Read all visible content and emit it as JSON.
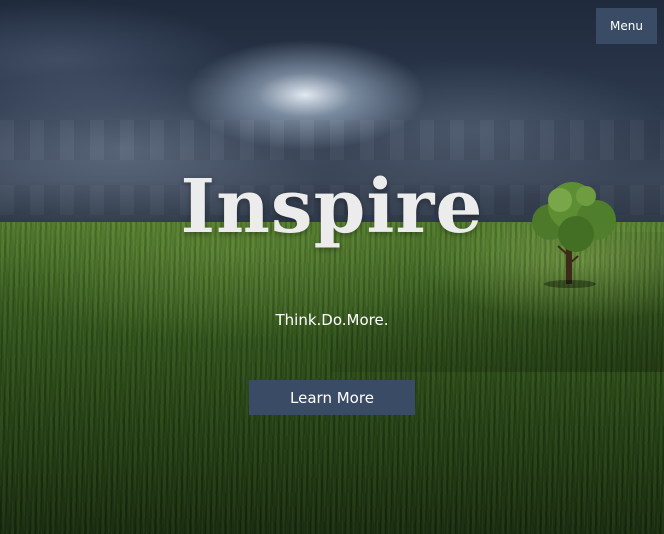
{
  "header": {
    "menu_label": "Menu"
  },
  "hero": {
    "title": "Inspire",
    "tagline": "Think.Do.More.",
    "cta_label": "Learn More",
    "background_description_icon": "landscape-image"
  },
  "colors": {
    "button_bg": "#3a4b66",
    "button_text": "#ffffff",
    "title_text": "#ececec"
  }
}
